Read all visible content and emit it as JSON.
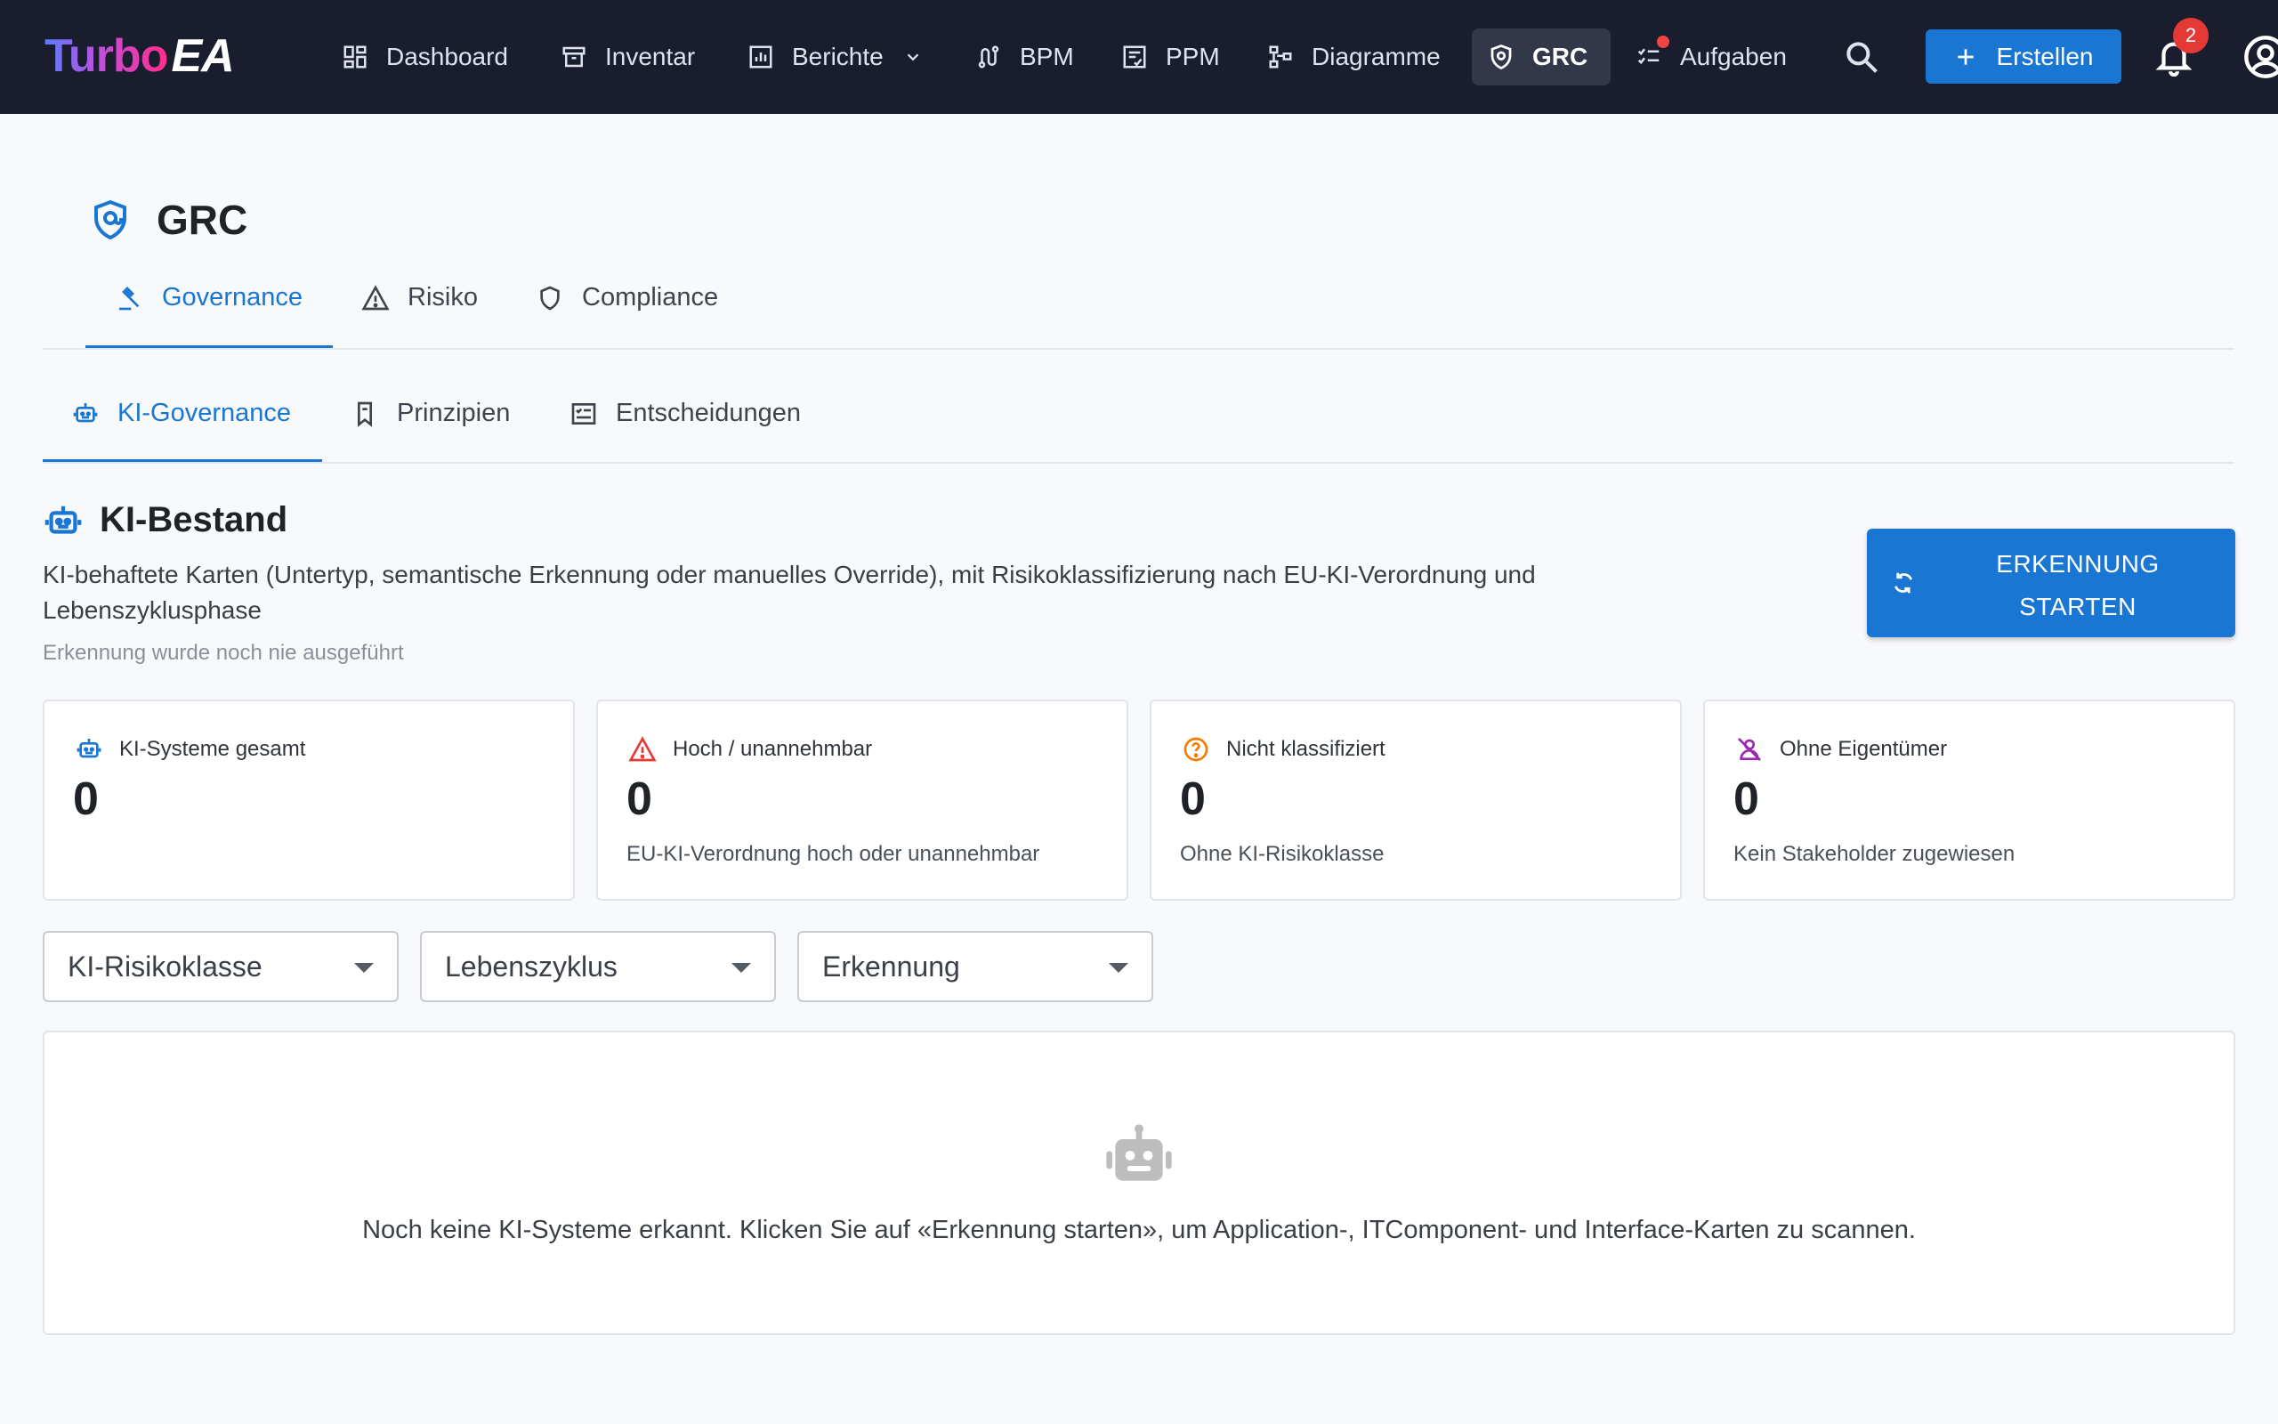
{
  "brand": {
    "part1": "Turbo",
    "part2": "EA"
  },
  "nav": {
    "items": [
      {
        "label": "Dashboard"
      },
      {
        "label": "Inventar"
      },
      {
        "label": "Berichte"
      },
      {
        "label": "BPM"
      },
      {
        "label": "PPM"
      },
      {
        "label": "Diagramme"
      },
      {
        "label": "GRC"
      },
      {
        "label": "Aufgaben"
      }
    ],
    "create_label": "Erstellen",
    "notification_count": "2"
  },
  "page": {
    "title": "GRC"
  },
  "tabs": [
    {
      "label": "Governance"
    },
    {
      "label": "Risiko"
    },
    {
      "label": "Compliance"
    }
  ],
  "subtabs": [
    {
      "label": "KI-Governance"
    },
    {
      "label": "Prinzipien"
    },
    {
      "label": "Entscheidungen"
    }
  ],
  "section": {
    "title": "KI-Bestand",
    "description": "KI-behaftete Karten (Untertyp, semantische Erkennung oder manuelles Override), mit Risikoklassifizierung nach EU-KI-Verordnung und Lebenszyklusphase",
    "note": "Erkennung wurde noch nie ausgeführt",
    "detect_button": {
      "line1": "ERKENNUNG",
      "line2": "STARTEN"
    }
  },
  "stats": [
    {
      "title": "KI-Systeme gesamt",
      "value": "0",
      "subtitle": ""
    },
    {
      "title": "Hoch / unannehmbar",
      "value": "0",
      "subtitle": "EU-KI-Verordnung hoch oder unannehmbar"
    },
    {
      "title": "Nicht klassifiziert",
      "value": "0",
      "subtitle": "Ohne KI-Risikoklasse"
    },
    {
      "title": "Ohne Eigentümer",
      "value": "0",
      "subtitle": "Kein Stakeholder zugewiesen"
    }
  ],
  "filters": [
    {
      "label": "KI-Risikoklasse"
    },
    {
      "label": "Lebenszyklus"
    },
    {
      "label": "Erkennung"
    }
  ],
  "empty_state": {
    "message": "Noch keine KI-Systeme erkannt. Klicken Sie auf «Erkennung starten», um Application-, ITComponent- und Interface-Karten zu scannen."
  },
  "colors": {
    "topbar": "#1a1d2e",
    "accent": "#1976d2",
    "danger": "#e53935",
    "warning": "#f57c00",
    "purple": "#9c27b0"
  }
}
